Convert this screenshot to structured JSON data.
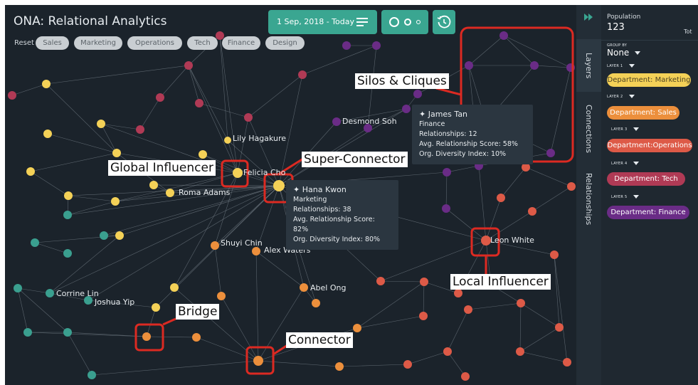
{
  "app": {
    "title": "ONA: Relational Analytics"
  },
  "filters": {
    "reset_label": "Reset",
    "chips": [
      "Sales",
      "Marketing",
      "Operations",
      "Tech",
      "Finance",
      "Design"
    ]
  },
  "toolbar": {
    "date_range": "1 Sep, 2018 - Today",
    "list_icon": "list-icon",
    "size_icon": "node-size-icon",
    "history_icon": "history-icon"
  },
  "colors": {
    "marketing": "#f4d157",
    "sales": "#ec8f3c",
    "operations": "#dd5a47",
    "tech": "#b03a55",
    "finance": "#6a2c86",
    "design": "#3a9f8f",
    "callout_red": "#dc2a22",
    "teal_button": "#3aa691"
  },
  "node_labels": {
    "lily": "Lily Hagakure",
    "felicia": "Felicia Cho",
    "roma": "Roma Adams",
    "desmond": "Desmond Soh",
    "shuyi": "Shuyi Chin",
    "alex": "Alex Waters",
    "abel": "Abel Ong",
    "corrine": "Corrine Lin",
    "joshua": "Joshua Yip",
    "leon": "Leon White"
  },
  "tooltips": {
    "james": {
      "name": "James Tan",
      "dept": "Finance",
      "rel": "Relationships: 12",
      "score": "Avg. Relationship Score: 58%",
      "diversity": "Org. Diversity Index: 10%"
    },
    "hana": {
      "name": "Hana Kwon",
      "dept": "Marketing",
      "rel": "Relationships: 38",
      "score": "Avg. Relationship Score: 82%",
      "diversity": "Org. Diversity Index: 80%"
    }
  },
  "callouts": {
    "silos": "Silos & Cliques",
    "super": "Super-Connector",
    "global": "Global Influencer",
    "local": "Local  Influencer",
    "bridge": "Bridge",
    "connector": "Connector"
  },
  "sidebar_tabs": {
    "collapse_icon": "double-chevron-right-icon",
    "layers": "Layers",
    "connections": "Connections",
    "relationships": "Relationships"
  },
  "panel": {
    "population_label": "Population",
    "population_value": "123",
    "total_label": "Tot",
    "group_by_label": "GROUP BY",
    "group_by_value": "None",
    "layers": [
      {
        "label": "LAYER 1",
        "pill": "Department: Marketing",
        "color": "#f4d157"
      },
      {
        "label": "LAYER 2",
        "pill": "Department: Sales",
        "color": "#ec8f3c"
      },
      {
        "label": "LAYER 3",
        "pill": "Department:Operations",
        "color": "#dd5a47"
      },
      {
        "label": "LAYER 4",
        "pill": "Department: Tech",
        "color": "#b03a55"
      },
      {
        "label": "LAYER 5",
        "pill": "Department: Finance",
        "color": "#6a2c86"
      }
    ]
  }
}
